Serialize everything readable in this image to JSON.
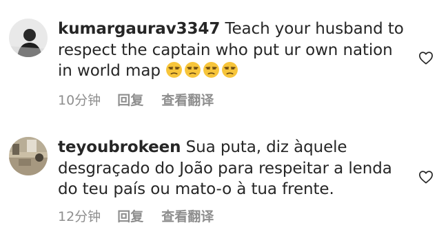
{
  "comments": [
    {
      "username": "kumargaurav3347",
      "text": "Teach your husband to respect the captain who put ur own nation in world map",
      "emoji_icons": [
        "unamused-face-icon",
        "unamused-face-icon",
        "unamused-face-icon",
        "unamused-face-icon"
      ],
      "time": "10分钟",
      "reply_label": "回复",
      "translate_label": "查看翻译",
      "like_icon": "heart-outline-icon"
    },
    {
      "username": "teyoubrokeen",
      "text": "Sua puta, diz àquele desgraçado do João para respeitar a lenda do teu país ou mato-o à tua frente.",
      "time": "12分钟",
      "reply_label": "回复",
      "translate_label": "查看翻译",
      "like_icon": "heart-outline-icon"
    }
  ],
  "colors": {
    "text": "#262626",
    "meta": "#8e8e8e",
    "emoji": "#f7c53b"
  }
}
